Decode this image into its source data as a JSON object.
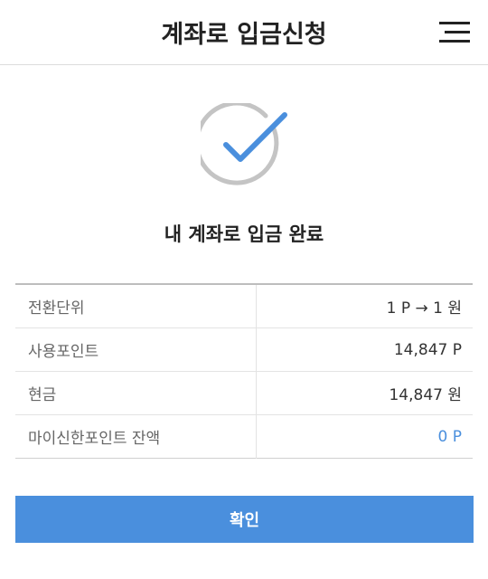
{
  "header": {
    "title": "계좌로 입금신청",
    "menu_icon": "hamburger-menu-icon"
  },
  "result": {
    "icon": "check-circle-icon",
    "title": "내 계좌로 입금 완료"
  },
  "details": {
    "rows": [
      {
        "label": "전환단위",
        "value": "1 P → 1 원"
      },
      {
        "label": "사용포인트",
        "value": "14,847 P"
      },
      {
        "label": "현금",
        "value": "14,847 원"
      },
      {
        "label": "마이신한포인트 잔액",
        "value": "0 P"
      }
    ]
  },
  "confirm": {
    "label": "확인"
  },
  "colors": {
    "accent": "#4a8fdd",
    "check_ring": "#c4c4c4",
    "check_mark": "#4a8fdd"
  }
}
